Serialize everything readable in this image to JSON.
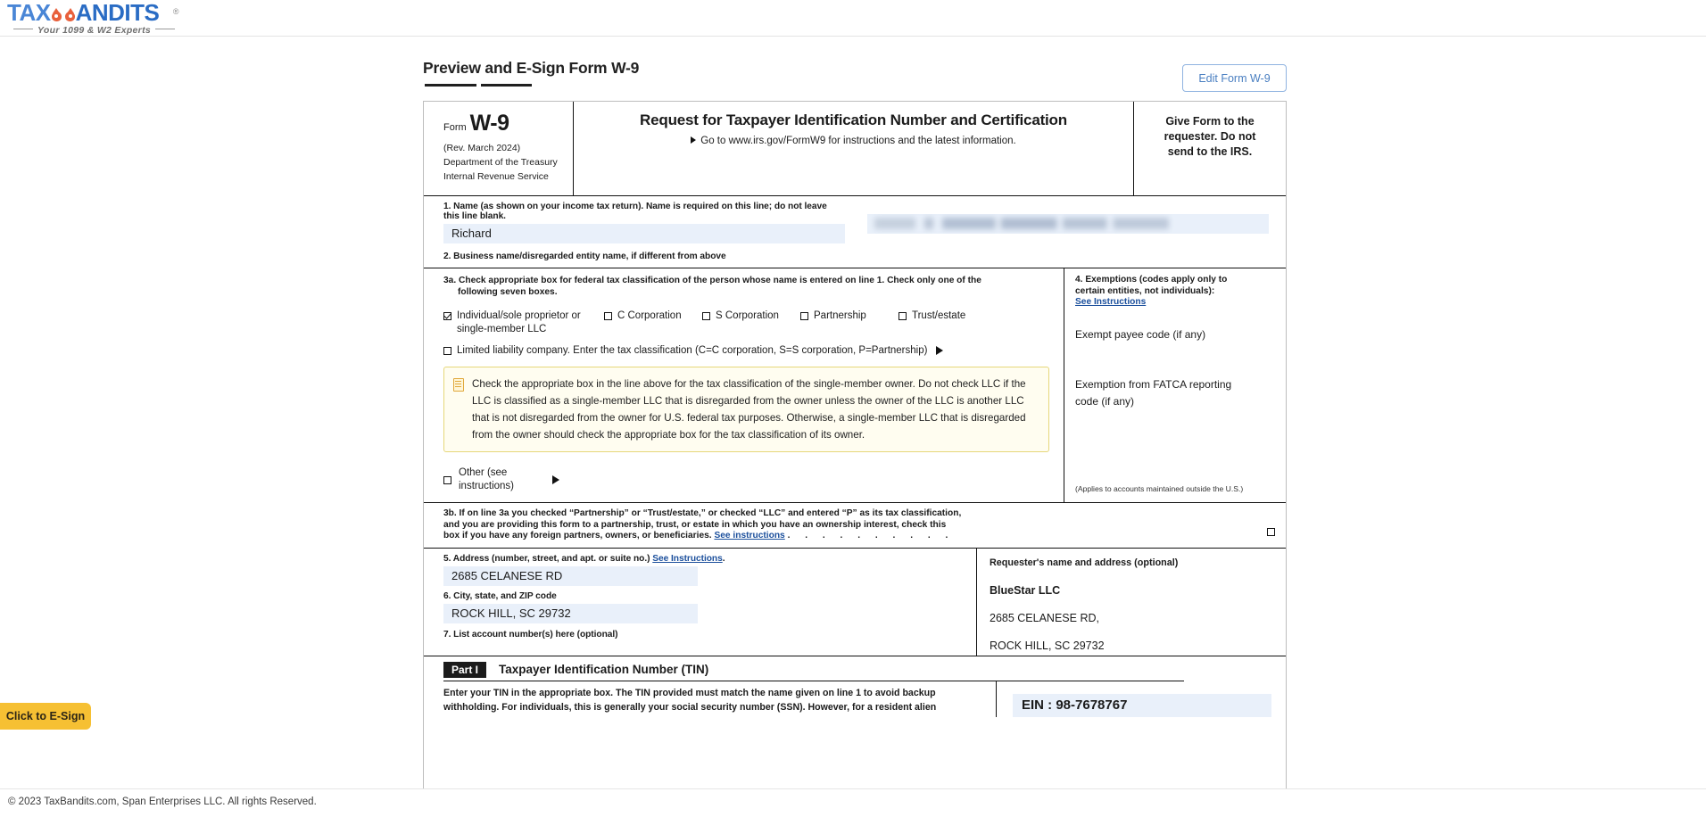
{
  "brand": {
    "name_part1": "TAX",
    "name_part2": "ANDITS",
    "trademark": "®",
    "tagline": "Your 1099 & W2 Experts",
    "mask_icon": "bandit-mask-icon"
  },
  "header": {
    "page_title": "Preview and E-Sign Form W-9",
    "edit_button": "Edit Form W-9"
  },
  "form": {
    "left_header": {
      "form_word": "Form",
      "form_number": "W-9",
      "revision": "(Rev. March 2024)",
      "dept_line1": "Department of the Treasury",
      "dept_line2": "Internal Revenue Service"
    },
    "center_header": {
      "title": "Request for Taxpayer Identification Number and Certification",
      "subtitle": "Go to www.irs.gov/FormW9 for instructions and the latest information."
    },
    "right_header": {
      "line1": "Give Form to the",
      "line2": "requester. Do not",
      "line3": "send to the IRS."
    },
    "line1": {
      "label": "1. Name (as shown on your income tax return). Name is required on this line; do not leave this line blank.",
      "value": "Richard",
      "secondary_value": "",
      "secondary_state": "redacted"
    },
    "line2": {
      "label": "2. Business name/disregarded entity name, if different from above",
      "value": ""
    },
    "line3a": {
      "label_line1": "3a. Check appropriate box for federal tax classification of the person whose name is entered on line 1. Check only one of the",
      "label_line2": "following seven boxes.",
      "options": [
        {
          "label": "Individual/sole proprietor or single-member LLC",
          "checked": true
        },
        {
          "label": "C Corporation",
          "checked": false
        },
        {
          "label": "S Corporation",
          "checked": false
        },
        {
          "label": "Partnership",
          "checked": false
        },
        {
          "label": "Trust/estate",
          "checked": false
        }
      ],
      "llc_option": {
        "label": "Limited liability company. Enter the tax classification (C=C corporation, S=S corporation, P=Partnership)",
        "checked": false
      },
      "other_option": {
        "label_line1": "Other (see",
        "label_line2": "instructions)",
        "checked": false
      }
    },
    "callout": {
      "icon": "note-icon",
      "text": "Check the appropriate box in the line above for the tax classification of the single-member owner. Do not check LLC if the LLC is classified as a single-member LLC that is disregarded from the owner unless the owner of the LLC is another LLC that is not disregarded from the owner for U.S. federal tax purposes. Otherwise, a single-member LLC that is disregarded from the owner should check the appropriate box for the tax classification of its owner."
    },
    "line4": {
      "label_line1": "4. Exemptions (codes apply only to",
      "label_line2": "certain entities, not individuals):",
      "link": "See Instructions",
      "exempt_payee_label": "Exempt payee code (if any)",
      "exempt_payee_value": "",
      "fatca_label_line1": "Exemption from FATCA reporting",
      "fatca_label_line2": "code (if any)",
      "fatca_value": "",
      "note": "(Applies to accounts maintained outside the U.S.)"
    },
    "line3b": {
      "text_line1": "3b. If on line 3a you checked “Partnership” or “Trust/estate,” or checked “LLC” and entered “P” as its tax classification,",
      "text_line2": "and you are providing this form to a partnership, trust, or estate in which you have an ownership interest, check this",
      "text_line3": "box if you have any foreign partners, owners, or beneficiaries.",
      "link": "See instructions",
      "dots": ".   .   .   .   .   .   .   .   .   .",
      "checked": false
    },
    "line5": {
      "label": "5. Address (number, street, and apt. or suite no.)",
      "link": "See Instructions",
      "label_end": ".",
      "value": "2685 CELANESE RD"
    },
    "line6": {
      "label": "6. City, state, and ZIP code",
      "value": "ROCK HILL, SC 29732"
    },
    "line7": {
      "label": "7. List account number(s) here (optional)",
      "value": ""
    },
    "requester": {
      "label": "Requester's name and address (optional)",
      "name": "BlueStar LLC",
      "address_line1": "2685 CELANESE RD,",
      "address_line2": "ROCK HILL, SC 29732"
    },
    "part1": {
      "tag": "Part I",
      "title": "Taxpayer Identification Number (TIN)",
      "text_line1": "Enter your TIN in the appropriate box. The TIN provided must match the name given on line 1 to avoid backup",
      "text_line2": "withholding. For individuals, this is generally your social security number (SSN). However, for a resident alien",
      "ein_value": "EIN : 98-7678767"
    }
  },
  "actions": {
    "esign_button": "Click to E-Sign"
  },
  "footer": {
    "copyright": "© 2023 TaxBandits.com, Span Enterprises LLC. All rights Reserved."
  },
  "colors": {
    "brand_blue": "#4a86d6",
    "accent_orange": "#e8603c",
    "link_blue": "#1b4f9c",
    "esign_yellow": "#f6c033",
    "field_fill": "#e9f0fa",
    "callout_bg": "#fffdf0",
    "callout_border": "#e6d77a"
  }
}
